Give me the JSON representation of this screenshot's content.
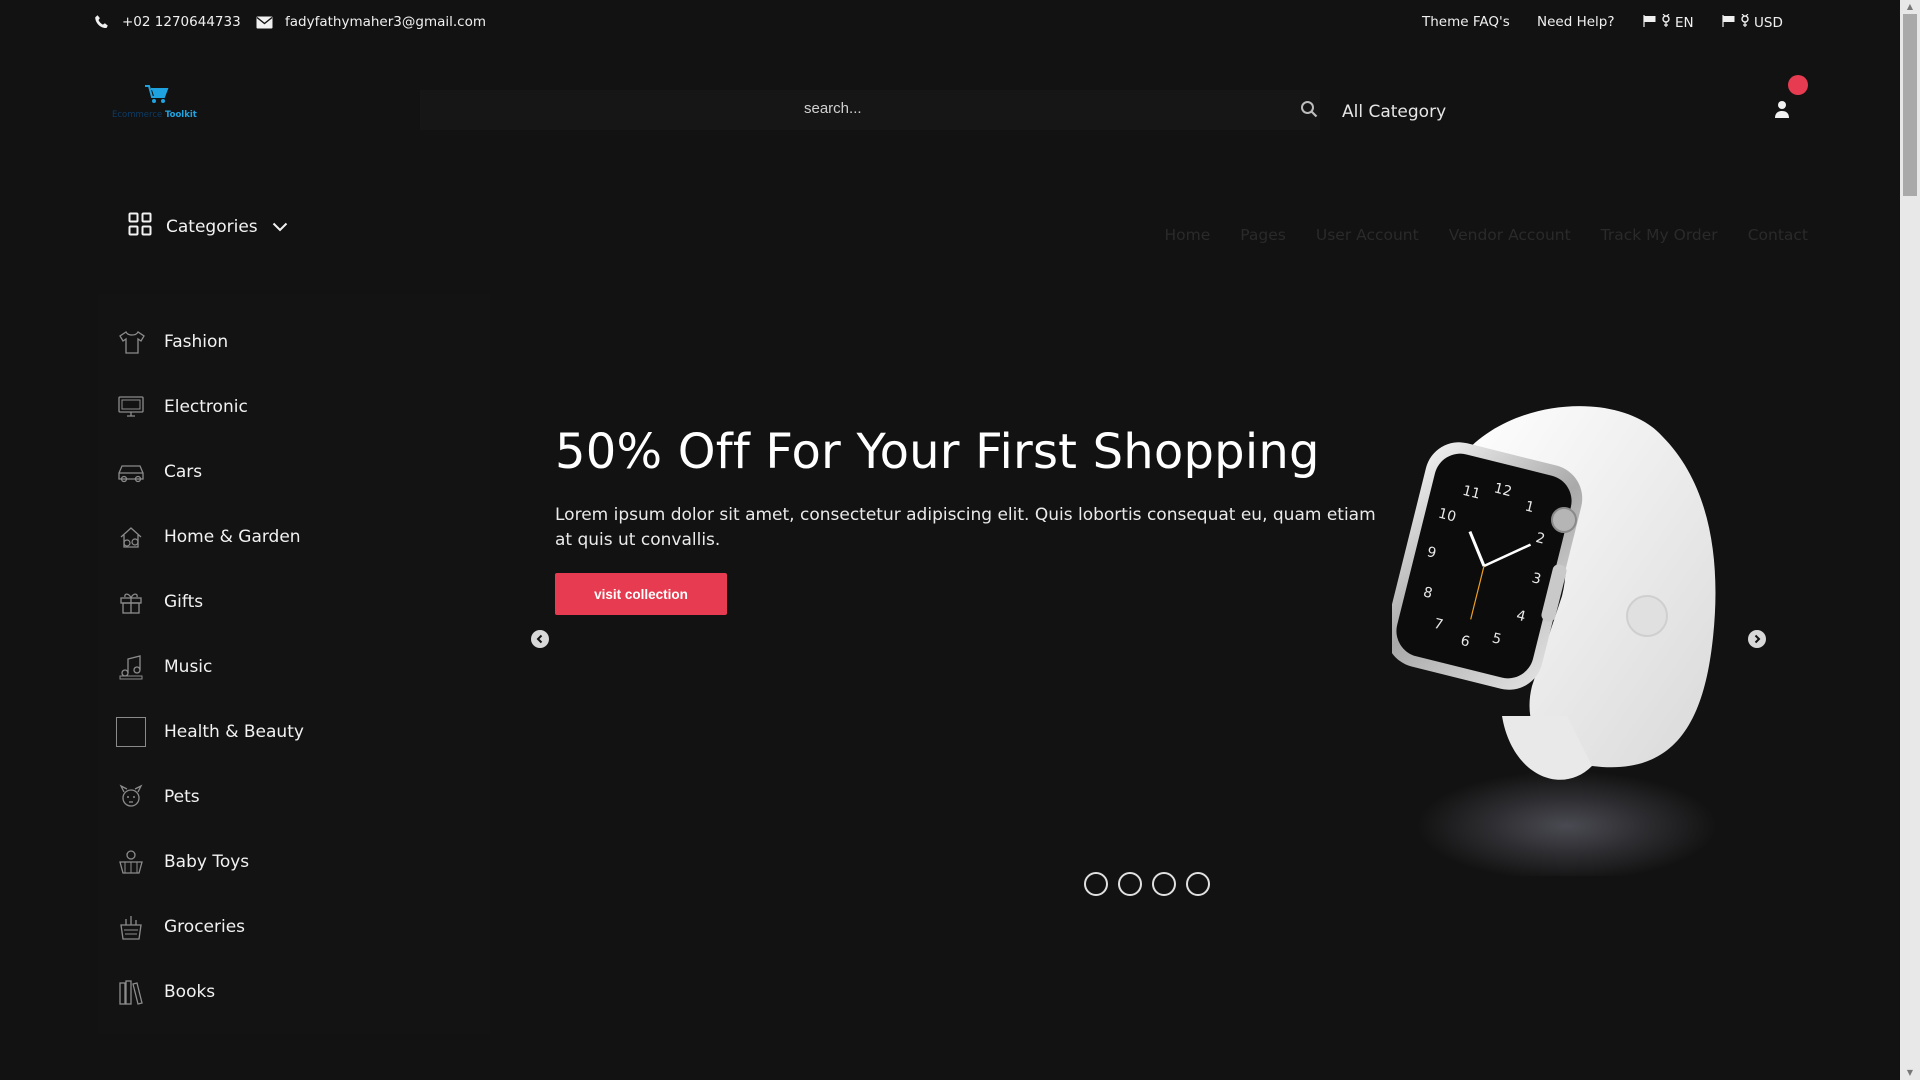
{
  "topbar": {
    "phone": "+02 1270644733",
    "email": "fadyfathymaher3@gmail.com",
    "faq": "Theme FAQ's",
    "help": "Need Help?",
    "language": "EN",
    "currency": "USD"
  },
  "logo": {
    "word1": "Ecommerce",
    "word2": "Toolkit"
  },
  "search": {
    "placeholder": "search...",
    "category": "All Category"
  },
  "categories_toggle": "Categories",
  "nav": [
    "Home",
    "Pages",
    "User Account",
    "Vendor Account",
    "Track My Order",
    "Contact"
  ],
  "sidebar": {
    "items": [
      {
        "label": "Fashion",
        "icon": "fashion-icon"
      },
      {
        "label": "Electronic",
        "icon": "electronic-icon"
      },
      {
        "label": "Cars",
        "icon": "car-icon"
      },
      {
        "label": "Home & Garden",
        "icon": "home-garden-icon"
      },
      {
        "label": "Gifts",
        "icon": "gift-icon"
      },
      {
        "label": "Music",
        "icon": "music-icon"
      },
      {
        "label": "Health & Beauty",
        "icon": "health-beauty-icon"
      },
      {
        "label": "Pets",
        "icon": "pets-icon"
      },
      {
        "label": "Baby Toys",
        "icon": "baby-toys-icon"
      },
      {
        "label": "Groceries",
        "icon": "groceries-icon"
      },
      {
        "label": "Books",
        "icon": "books-icon"
      }
    ]
  },
  "hero": {
    "title": "50% Off For Your First Shopping",
    "description": "Lorem ipsum dolor sit amet, consectetur adipiscing elit. Quis lobortis consequat eu, quam etiam at quis ut convallis.",
    "button": "visit collection",
    "watch_digits": [
      "12",
      "1",
      "2",
      "3",
      "4",
      "5",
      "6",
      "7",
      "8",
      "9",
      "10",
      "11"
    ]
  },
  "colors": {
    "accent": "#e63b50",
    "background": "#121212",
    "logo_blue": "#1fa3e0"
  }
}
